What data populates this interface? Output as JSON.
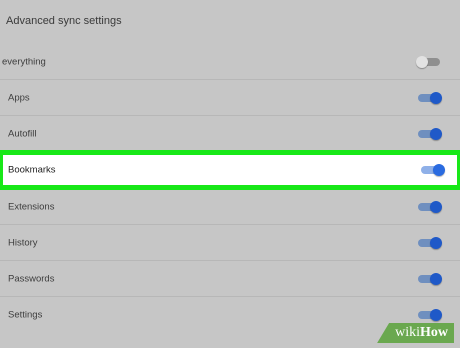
{
  "header": {
    "title": "Advanced sync settings"
  },
  "rows": [
    {
      "label": "everything",
      "enabled": false
    },
    {
      "label": "Apps",
      "enabled": true
    },
    {
      "label": "Autofill",
      "enabled": true
    },
    {
      "label": "Bookmarks",
      "enabled": true,
      "highlighted": true
    },
    {
      "label": "Extensions",
      "enabled": true
    },
    {
      "label": "History",
      "enabled": true
    },
    {
      "label": "Passwords",
      "enabled": true
    },
    {
      "label": "Settings",
      "enabled": true
    }
  ],
  "colors": {
    "background": "#c6c6c6",
    "highlight": "#18e818",
    "toggle_on_knob": "#1f59c8",
    "watermark": "#6aa84f"
  },
  "watermark": {
    "part1": "wiki",
    "part2": "How"
  }
}
